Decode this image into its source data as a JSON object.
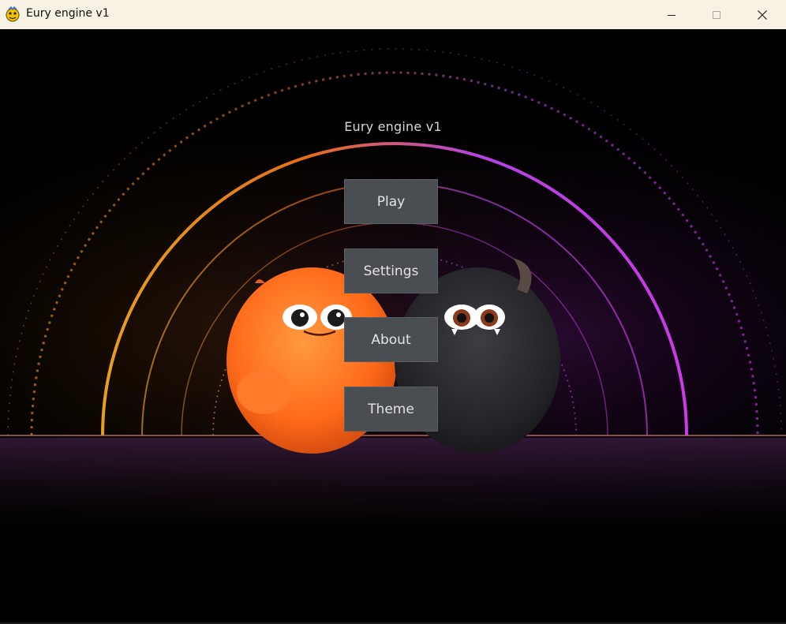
{
  "window": {
    "title": "Eury engine v1",
    "app_icon": "pygame-snake-icon",
    "controls": [
      "minimize-icon",
      "maximize-icon",
      "close-icon"
    ]
  },
  "game": {
    "title": "Eury engine v1",
    "menu": [
      {
        "label": "Play"
      },
      {
        "label": "Settings"
      },
      {
        "label": "About"
      },
      {
        "label": "Theme"
      }
    ],
    "background": {
      "description_colors": {
        "left_glow": "#ffb020",
        "right_glow": "#e040ff",
        "orange_monster": "#ff6a1a",
        "black_monster": "#2a2a2e"
      }
    }
  },
  "colors": {
    "titlebar_bg": "#f8f2e4",
    "button_bg": "#4a4e52",
    "button_text": "#e3e3e3",
    "title_text": "#d7d7d7"
  }
}
